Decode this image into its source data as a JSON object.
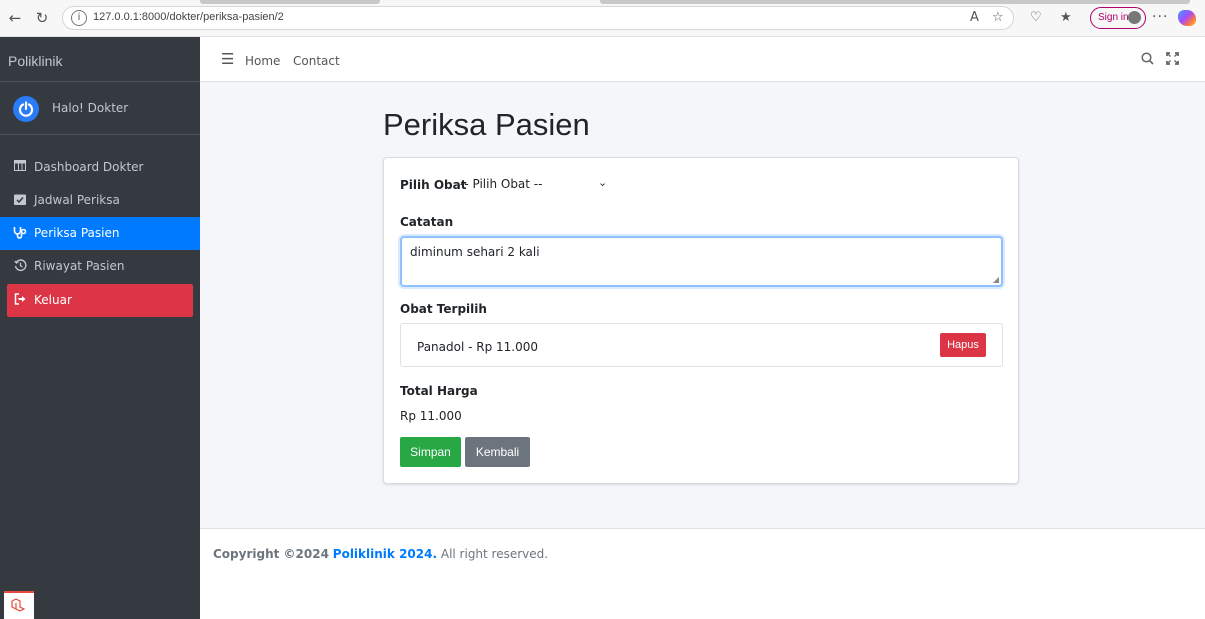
{
  "browser": {
    "url": "127.0.0.1:8000/dokter/periksa-pasien/2",
    "signin_label": "Sign in",
    "more_label": "···"
  },
  "sidebar": {
    "brand": "Poliklinik",
    "user_name": "Halo! Dokter",
    "items": [
      {
        "label": "Dashboard Dokter",
        "icon": "table-icon"
      },
      {
        "label": "Jadwal Periksa",
        "icon": "calendar-check-icon"
      },
      {
        "label": "Periksa Pasien",
        "icon": "stethoscope-icon",
        "active": true
      },
      {
        "label": "Riwayat Pasien",
        "icon": "history-icon"
      },
      {
        "label": "Keluar",
        "icon": "sign-out-icon"
      }
    ]
  },
  "topbar": {
    "home_label": "Home",
    "contact_label": "Contact"
  },
  "main": {
    "title": "Periksa Pasien",
    "pilih_obat_label": "Pilih Obat",
    "pilih_obat_value": "-- Pilih Obat --",
    "catatan_label": "Catatan",
    "catatan_value": "diminum sehari 2 kali",
    "obat_terpilih_label": "Obat Terpilih",
    "obat_terpilih": [
      {
        "name": "Panadol - Rp 11.000",
        "remove_label": "Hapus"
      }
    ],
    "total_harga_label": "Total Harga",
    "total_harga_value": "Rp 11.000",
    "simpan_label": "Simpan",
    "kembali_label": "Kembali"
  },
  "footer": {
    "copyright_prefix": "Copyright ©2024",
    "brand_link": "Poliklinik 2024.",
    "suffix": "All right reserved."
  },
  "colors": {
    "sidebar_bg": "#343a40",
    "active_item": "#007bff",
    "logout_item": "#dc3545",
    "simpan_button": "#28a745",
    "kembali_button": "#6c757d",
    "hapus_button": "#dc3545"
  }
}
